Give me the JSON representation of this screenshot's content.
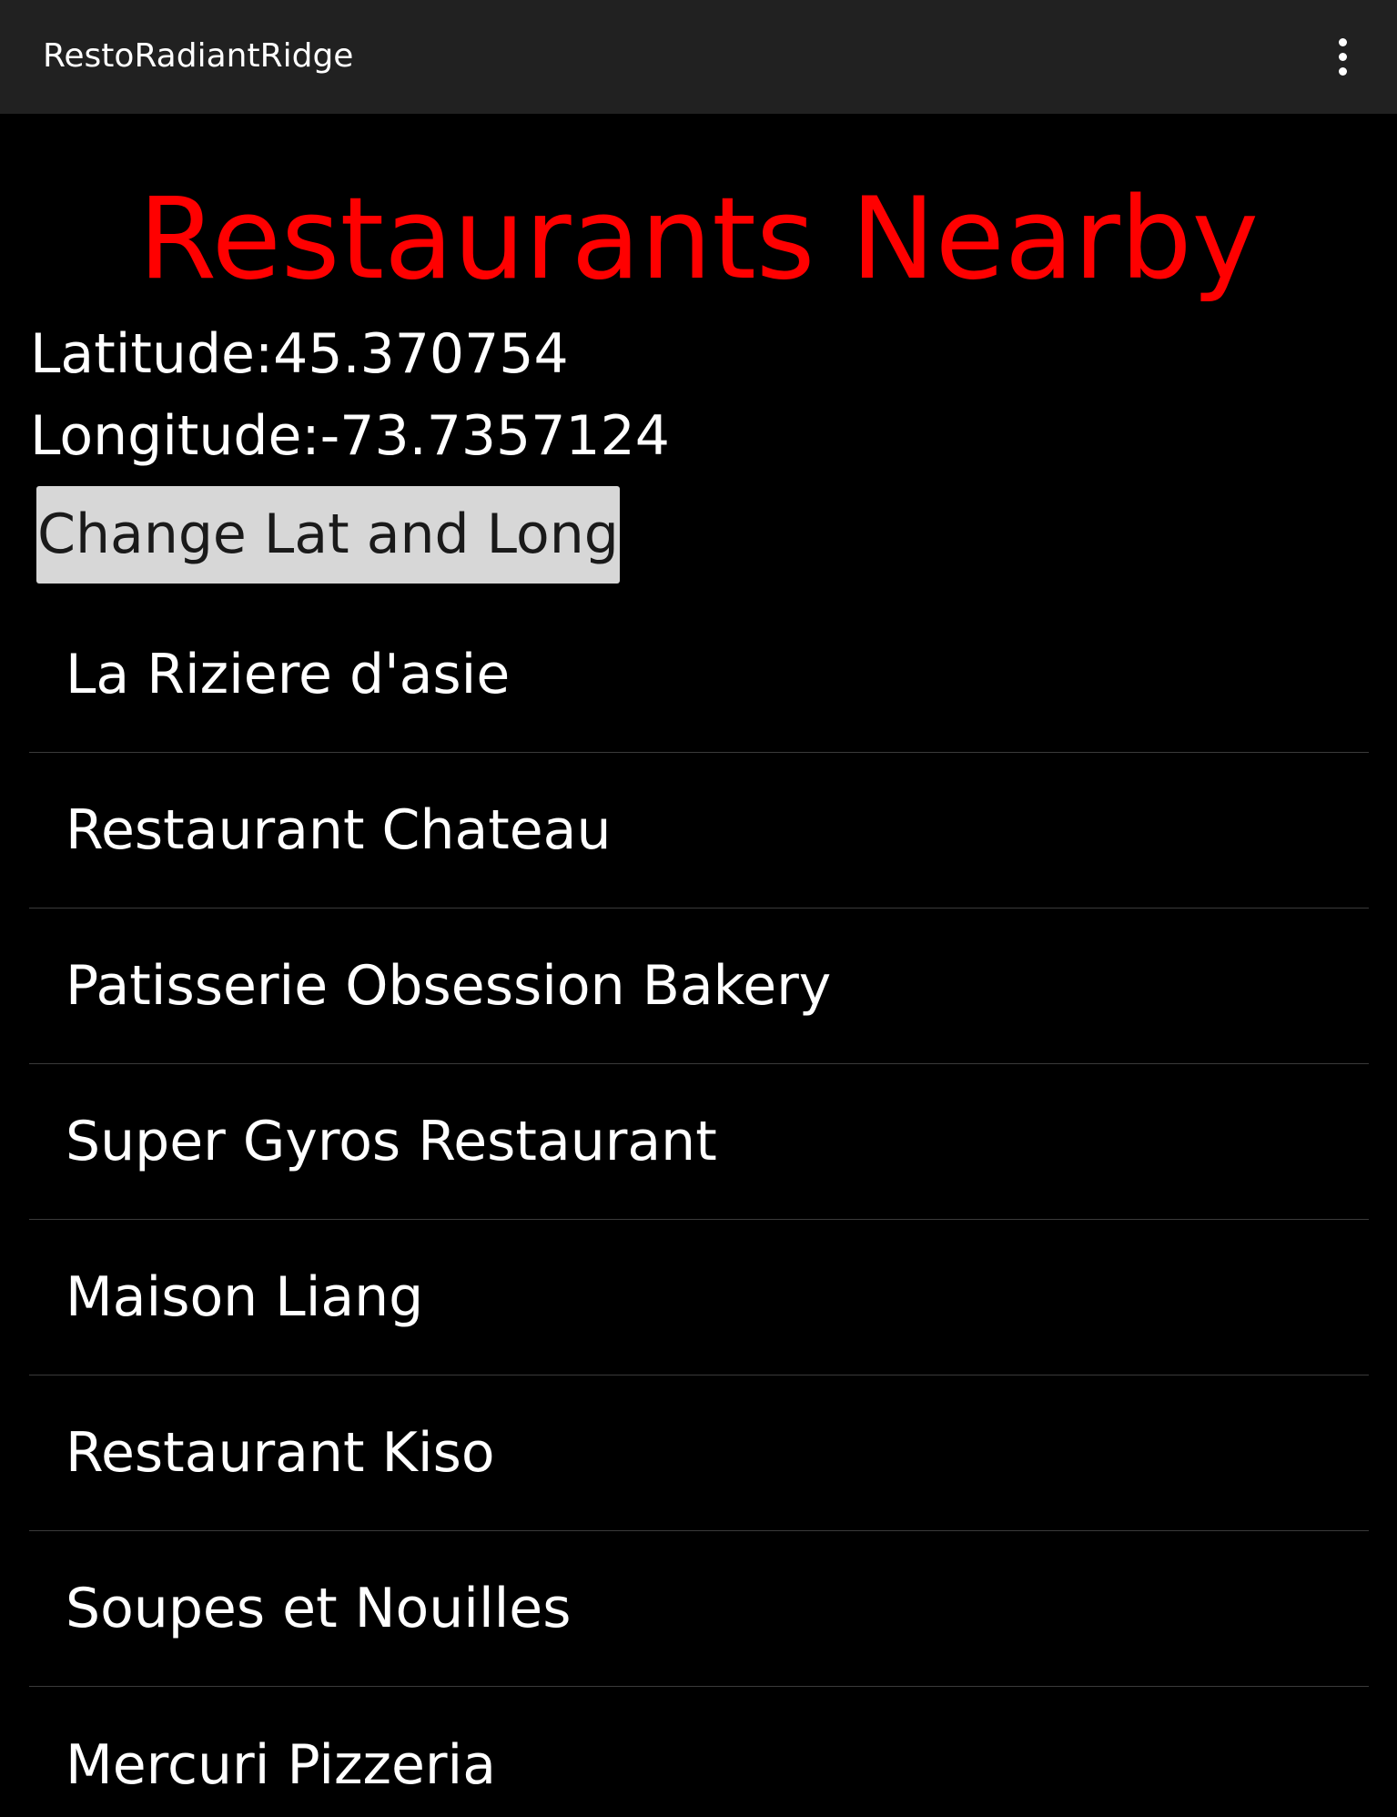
{
  "app_bar": {
    "title": "RestoRadiantRidge",
    "overflow_icon": "more-vert-icon"
  },
  "main": {
    "headline": "Restaurants Nearby",
    "headline_color": "#ff0000",
    "latitude_text": "Latitude:45.370754",
    "longitude_text": "Longitude:-73.7357124",
    "change_button_label": "Change Lat and Long"
  },
  "restaurants": [
    "La Riziere d'asie",
    "Restaurant Chateau",
    "Patisserie Obsession Bakery",
    "Super Gyros Restaurant",
    "Maison Liang",
    "Restaurant Kiso",
    "Soupes et Nouilles",
    "Mercuri Pizzeria"
  ]
}
